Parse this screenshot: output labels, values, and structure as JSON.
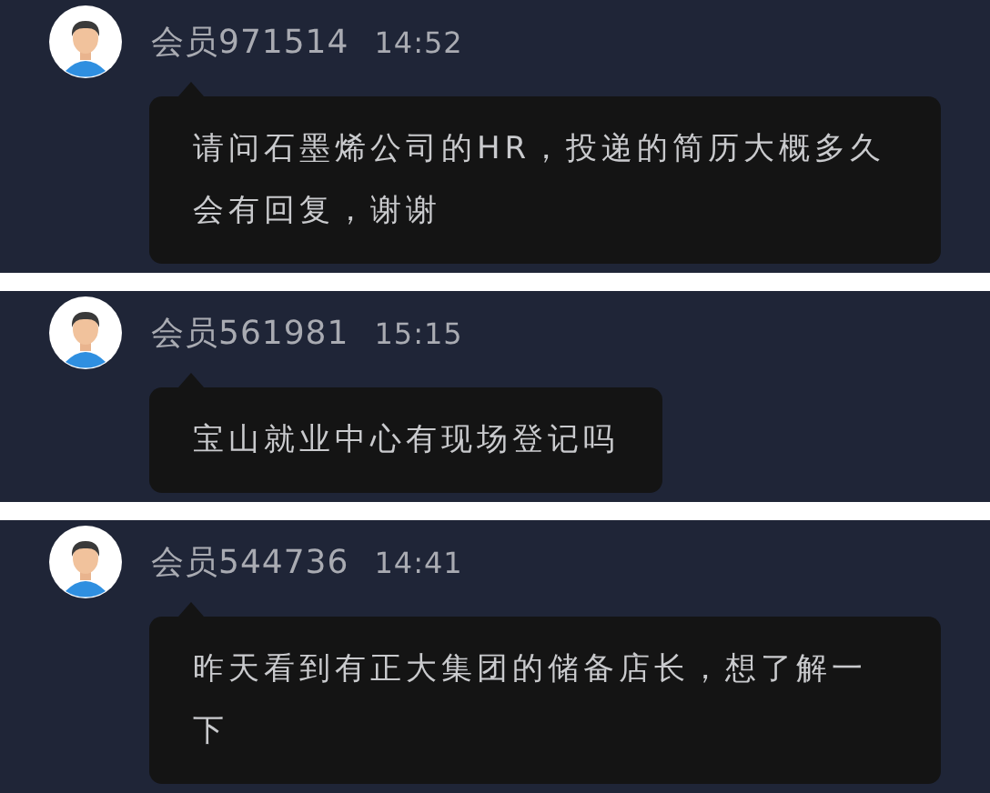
{
  "messages": [
    {
      "user": "会员971514",
      "time": "14:52",
      "text": "请问石墨烯公司的HR，投递的简历大概多久会有回复，谢谢"
    },
    {
      "user": "会员561981",
      "time": "15:15",
      "text": "宝山就业中心有现场登记吗"
    },
    {
      "user": "会员544736",
      "time": "14:41",
      "text": "昨天看到有正大集团的储备店长，想了解一下"
    }
  ]
}
